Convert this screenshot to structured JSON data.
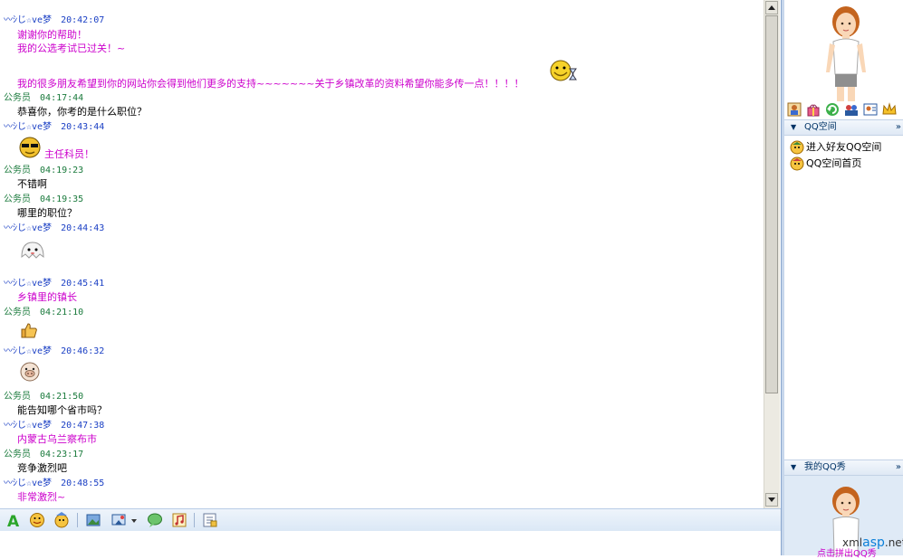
{
  "chat": {
    "messages": [
      {
        "name": "〰ｼじ☆ve梦",
        "time": "20:42:07",
        "side": "her",
        "lines": [
          "谢谢你的帮助！",
          "我的公选考试已过关！~"
        ]
      },
      {
        "name": "",
        "time": "",
        "side": "her",
        "lines": [
          "我的很多朋友希望到你的网站你会得到他们更多的支持~~~~~~~关于乡镇改革的资料希望你能多传一点！！！！"
        ],
        "emoji": "grin-hourglass-emoji"
      },
      {
        "name": "公务员",
        "time": "04:17:44",
        "side": "me",
        "lines": [
          "恭喜你，你考的是什么职位？"
        ]
      },
      {
        "name": "〰ｼじ☆ve梦",
        "time": "20:43:44",
        "side": "her",
        "lines": [
          "主任科员！"
        ],
        "emoji": "sunglasses-emoji"
      },
      {
        "name": "公务员",
        "time": "04:19:23",
        "side": "me",
        "lines": [
          "不错啊"
        ]
      },
      {
        "name": "公务员",
        "time": "04:19:35",
        "side": "me",
        "lines": [
          "哪里的职位？"
        ]
      },
      {
        "name": "〰ｼじ☆ve梦",
        "time": "20:44:43",
        "side": "her",
        "lines": [],
        "emoji": "ghost-emoji"
      },
      {
        "name": "〰ｼじ☆ve梦",
        "time": "20:45:41",
        "side": "her",
        "lines": [
          "乡镇里的镇长"
        ]
      },
      {
        "name": "公务员",
        "time": "04:21:10",
        "side": "me",
        "lines": [],
        "emoji": "thumbs-up-emoji"
      },
      {
        "name": "〰ｼじ☆ve梦",
        "time": "20:46:32",
        "side": "her",
        "lines": [],
        "emoji": "pig-emoji"
      },
      {
        "name": "公务员",
        "time": "04:21:50",
        "side": "me",
        "lines": [
          "能告知哪个省市吗？"
        ]
      },
      {
        "name": "〰ｼじ☆ve梦",
        "time": "20:47:38",
        "side": "her",
        "lines": [
          "内蒙古乌兰察布市"
        ]
      },
      {
        "name": "公务员",
        "time": "04:23:17",
        "side": "me",
        "lines": [
          "竞争激烈吧"
        ]
      },
      {
        "name": "〰ｼじ☆ve梦",
        "time": "20:48:55",
        "side": "her",
        "lines": [
          "非常激烈~"
        ]
      }
    ]
  },
  "colors": {
    "her_name": "#1a3fc4",
    "me_name": "#1a7a3c",
    "her_text": "#cc00cc",
    "me_text": "#000000"
  },
  "toolbar": {
    "icons": [
      "font-icon",
      "emoticon-icon",
      "magic-face-icon",
      "send-image-icon",
      "screenshot-icon",
      "screenshot-dropdown-icon",
      "chat-bubble-icon",
      "music-icon",
      "message-history-icon"
    ]
  },
  "right": {
    "qzone": {
      "title": "QQ空间",
      "more": "»",
      "links": [
        "进入好友QQ空间",
        "QQ空间首页"
      ]
    },
    "qqshow": {
      "title": "我的QQ秀",
      "more": "»",
      "caption": "点击拼出QQ秀"
    },
    "friend_icons": [
      "add-friend-icon",
      "gift-icon",
      "refresh-icon",
      "group-icon",
      "card-icon",
      "crown-icon"
    ]
  },
  "watermark": {
    "prefix": "xml",
    "mid": "asp",
    "suffix": ".net"
  }
}
